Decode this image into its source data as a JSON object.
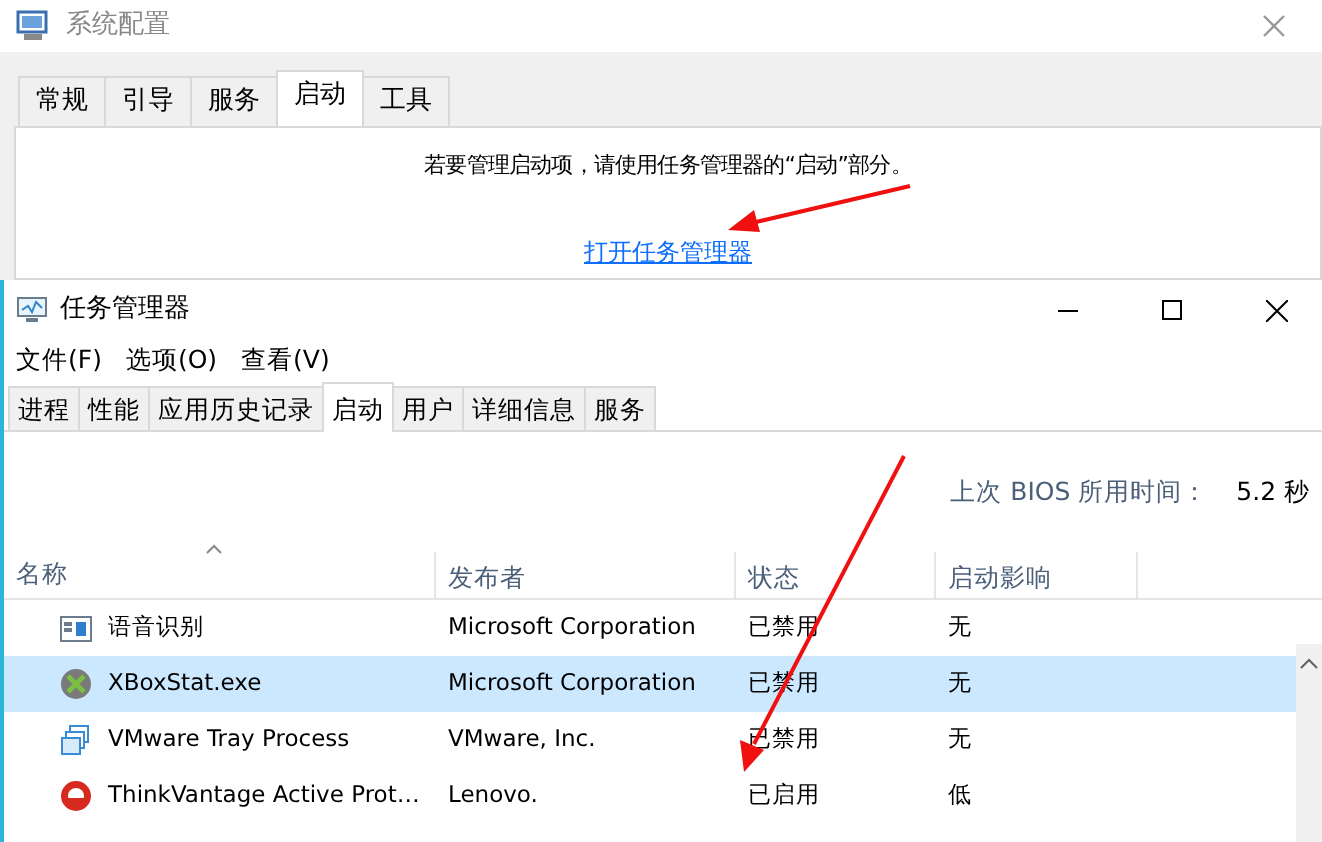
{
  "system_config": {
    "title": "系统配置",
    "tabs": [
      {
        "label": "常规",
        "selected": false
      },
      {
        "label": "引导",
        "selected": false
      },
      {
        "label": "服务",
        "selected": false
      },
      {
        "label": "启动",
        "selected": true
      },
      {
        "label": "工具",
        "selected": false
      }
    ],
    "message": "若要管理启动项，请使用任务管理器的“启动”部分。",
    "link": "打开任务管理器"
  },
  "task_manager": {
    "title": "任务管理器",
    "menu": [
      "文件(F)",
      "选项(O)",
      "查看(V)"
    ],
    "tabs": [
      {
        "label": "进程",
        "selected": false
      },
      {
        "label": "性能",
        "selected": false
      },
      {
        "label": "应用历史记录",
        "selected": false
      },
      {
        "label": "启动",
        "selected": true
      },
      {
        "label": "用户",
        "selected": false
      },
      {
        "label": "详细信息",
        "selected": false
      },
      {
        "label": "服务",
        "selected": false
      }
    ],
    "bios_label": "上次 BIOS 所用时间：",
    "bios_value": "5.2 秒",
    "columns": [
      "名称",
      "发布者",
      "状态",
      "启动影响"
    ],
    "rows": [
      {
        "kind": "window",
        "name": "语音识别",
        "publisher": "Microsoft Corporation",
        "status": "已禁用",
        "impact": "无",
        "selected": false
      },
      {
        "kind": "xbox",
        "name": "XBoxStat.exe",
        "publisher": "Microsoft Corporation",
        "status": "已禁用",
        "impact": "无",
        "selected": true
      },
      {
        "kind": "vmware",
        "name": "VMware Tray Process",
        "publisher": "VMware, Inc.",
        "status": "已禁用",
        "impact": "无",
        "selected": false
      },
      {
        "kind": "lenovo",
        "name": "ThinkVantage Active Prot…",
        "publisher": "Lenovo.",
        "status": "已启用",
        "impact": "低",
        "selected": false
      }
    ]
  }
}
